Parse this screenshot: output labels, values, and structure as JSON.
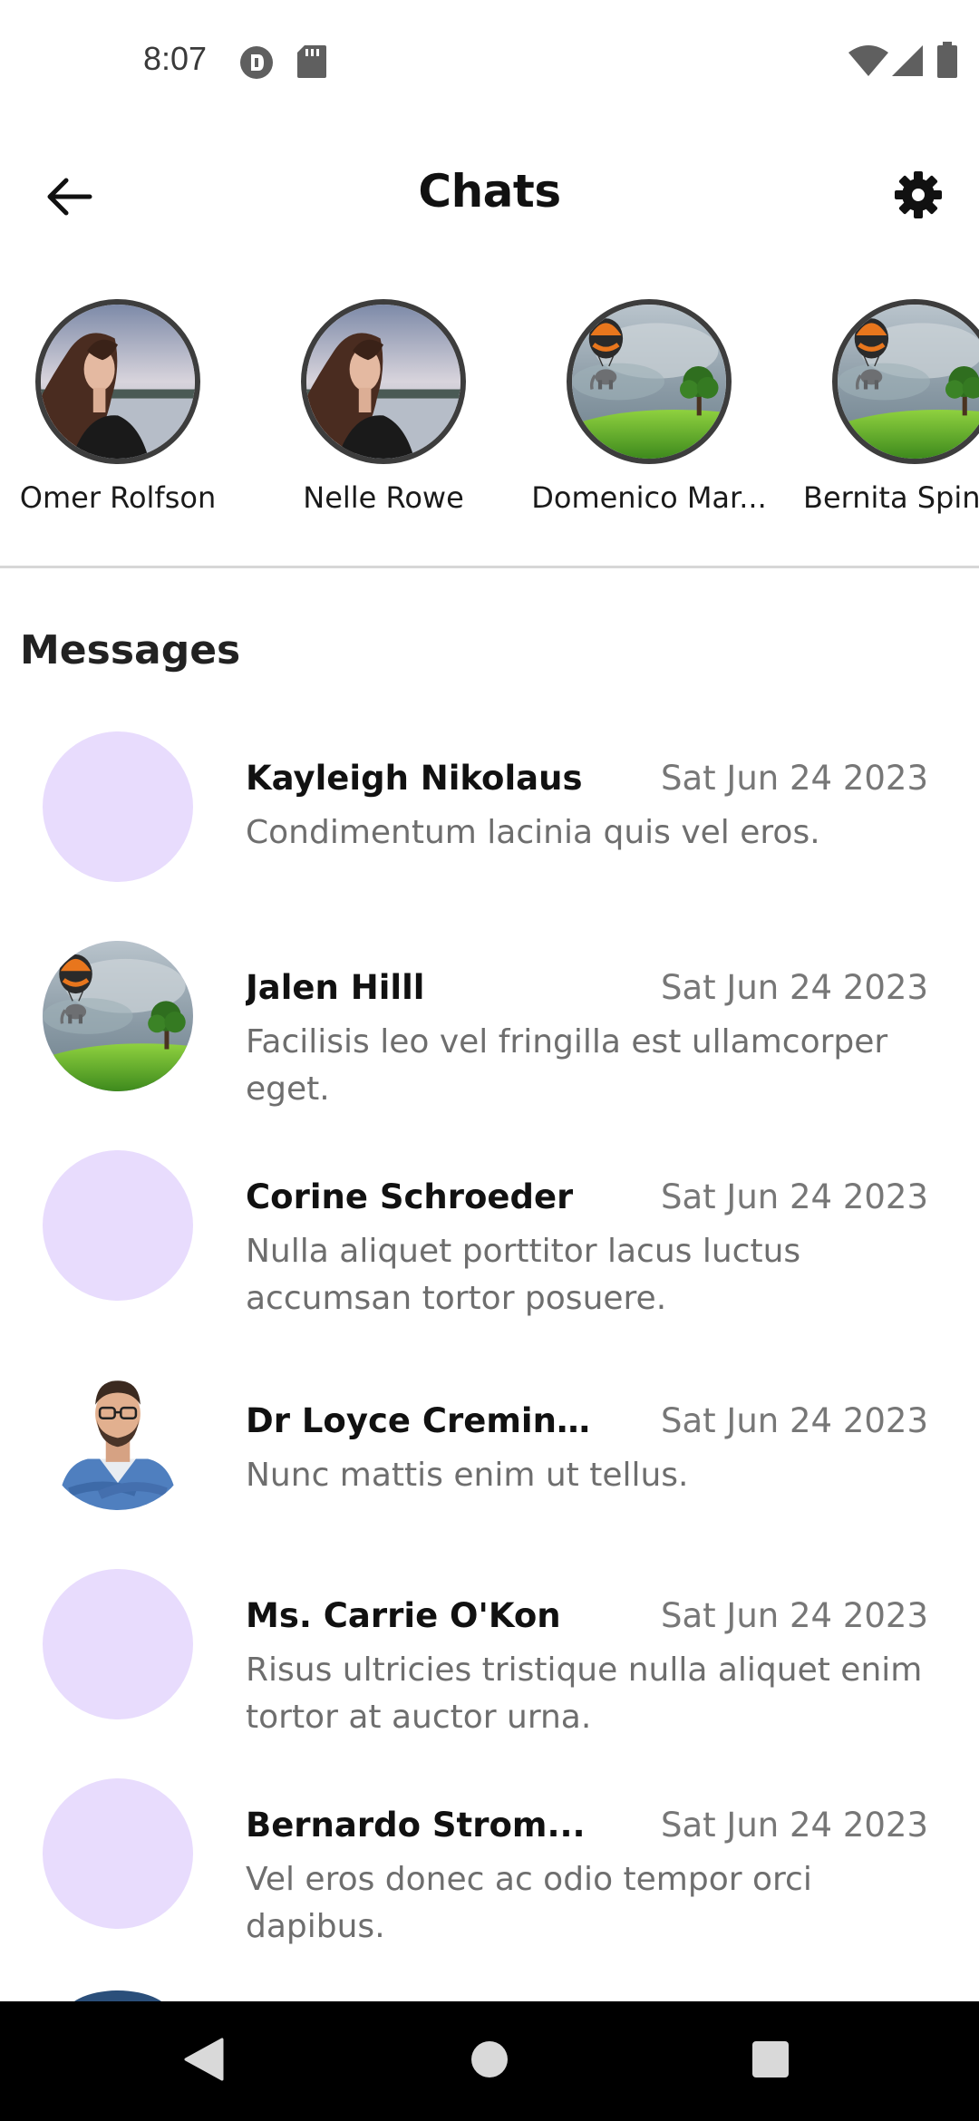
{
  "status_bar": {
    "time": "8:07",
    "icons": [
      "data-saver-icon",
      "sd-card-icon",
      "wifi-icon",
      "signal-icon",
      "battery-icon"
    ]
  },
  "app_bar": {
    "title": "Chats",
    "back_icon": "arrow-left-icon",
    "settings_icon": "gear-icon"
  },
  "stories": [
    {
      "name": "Omer Rolfson",
      "image": "woman-lake-photo"
    },
    {
      "name": "Nelle Rowe",
      "image": "woman-lake-photo"
    },
    {
      "name": "Domenico Mar...",
      "image": "balloon-elephant-landscape"
    },
    {
      "name": "Bernita Spink",
      "image": "balloon-elephant-landscape"
    }
  ],
  "messages_section": {
    "title": "Messages",
    "items": [
      {
        "name": "Kayleigh Nikolaus",
        "date": "Sat Jun 24 2023",
        "text": "Condimentum lacinia quis vel eros.",
        "avatar": "placeholder"
      },
      {
        "name": "Jalen Hilll",
        "date": "Sat Jun 24 2023",
        "text": "Facilisis leo vel fringilla est ullamcorper eget.",
        "avatar": "balloon-elephant-landscape"
      },
      {
        "name": "Corine Schroeder",
        "date": "Sat Jun 24 2023",
        "text": "Nulla aliquet porttitor lacus luctus accumsan tortor posuere.",
        "avatar": "placeholder"
      },
      {
        "name": "Dr Loyce Cremin...",
        "date": "Sat Jun 24 2023",
        "text": "Nunc mattis enim ut tellus.",
        "avatar": "man-portrait"
      },
      {
        "name": "Ms. Carrie O'Kon",
        "date": "Sat Jun 24 2023",
        "text": "Risus ultricies tristique nulla aliquet enim tortor at auctor urna.",
        "avatar": "placeholder"
      },
      {
        "name": "Bernardo Strom...",
        "date": "Sat Jun 24 2023",
        "text": "Vel eros donec ac odio tempor orci dapibus.",
        "avatar": "placeholder"
      }
    ]
  },
  "colors": {
    "avatar_placeholder": "#e8dcfd",
    "divider": "#d7d7d7",
    "nav_bar": "#000000"
  },
  "nav_bar": {
    "icons": [
      "back-triangle-icon",
      "home-circle-icon",
      "recents-square-icon"
    ]
  }
}
